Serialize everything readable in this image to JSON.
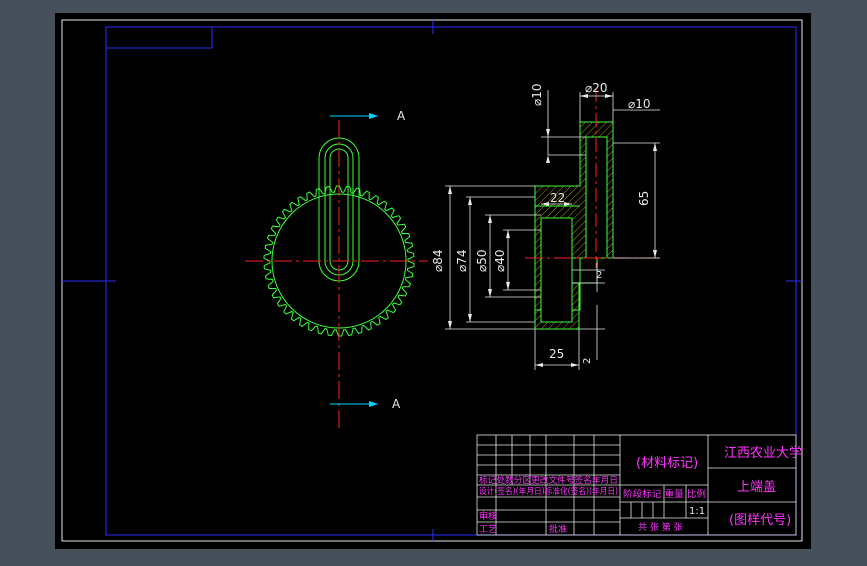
{
  "section_marks": {
    "top": "A",
    "bottom": "A"
  },
  "dimensions": {
    "d10_top": "⌀10",
    "d20": "⌀20",
    "d10_right": "⌀10",
    "d65": "65",
    "d22": "22",
    "d84": "⌀84",
    "d74": "⌀74",
    "d50": "⌀50",
    "d40": "⌀40",
    "d2_mid": "2",
    "d25": "25",
    "d2_bottom": "2"
  },
  "title_block": {
    "material": "(材料标记)",
    "school": "江西农业大学",
    "part_name": "上端盖",
    "drawing_no": "(图样代号)",
    "rev_row": "标记处数分区更改文件号签名年月日",
    "design_row": "设计(签名)(年月日)标准化(签名)(年月日)",
    "stage_labels": "阶段标记 重量 比例",
    "scale": "1:1",
    "sheets": "共 张 第 张",
    "review": "审核",
    "process": "工艺",
    "approve": "批准"
  }
}
